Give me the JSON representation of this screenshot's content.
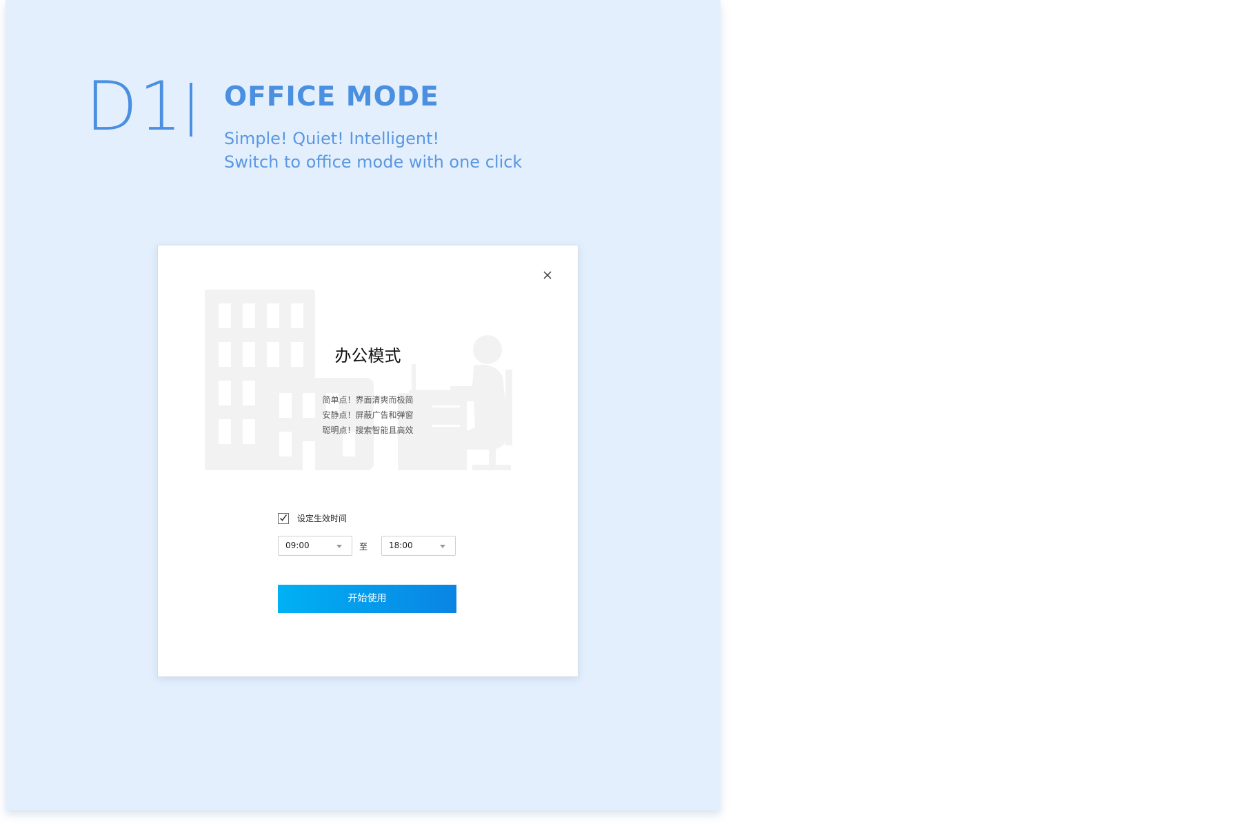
{
  "header": {
    "code": "D1",
    "title": "OFFICE MODE",
    "subtitle_line1": "Simple! Quiet! Intelligent!",
    "subtitle_line2": "Switch to office mode with one click"
  },
  "dialog": {
    "title": "办公模式",
    "descriptions": [
      "简单点！界面清爽而极简",
      "安静点！屏蔽广告和弹窗",
      "聪明点！搜索智能且高效"
    ],
    "checkbox_label": "设定生效时间",
    "checkbox_checked": true,
    "start_time": "09:00",
    "to_label": "至",
    "end_time": "18:00",
    "start_button": "开始使用",
    "close_icon": "close-icon"
  },
  "colors": {
    "panel_bg": "#e3effd",
    "accent": "#4a8fe0",
    "button_start": "#00b1f4",
    "button_end": "#0a84e3"
  }
}
